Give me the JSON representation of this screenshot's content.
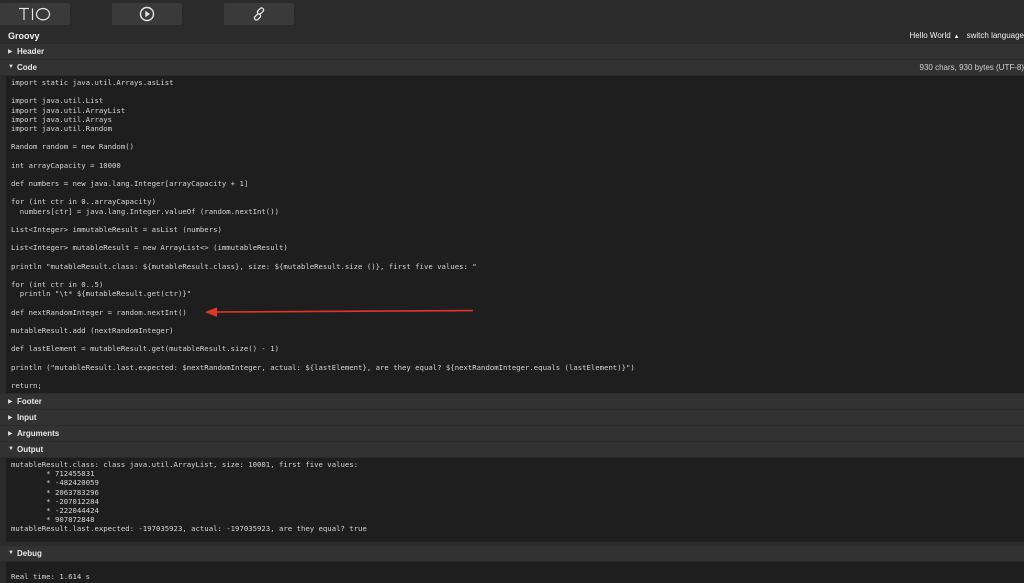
{
  "toolbar": {
    "logo": "TIO",
    "run_icon": "play-icon",
    "link_icon": "link-icon"
  },
  "language": {
    "name": "Groovy",
    "hello_world": "Hello World",
    "hello_world_icon": "triangle-up-icon",
    "switch_language": "switch language"
  },
  "sections": {
    "header": "Header",
    "code": "Code",
    "code_info": "930 chars, 930 bytes (UTF-8)",
    "footer": "Footer",
    "input": "Input",
    "arguments": "Arguments",
    "output": "Output",
    "debug": "Debug"
  },
  "code_lines": [
    "import static java.util.Arrays.asList",
    "",
    "import java.util.List",
    "import java.util.ArrayList",
    "import java.util.Arrays",
    "import java.util.Random",
    "",
    "Random random = new Random()",
    "",
    "int arrayCapacity = 10000",
    "",
    "def numbers = new java.lang.Integer[arrayCapacity + 1]",
    "",
    "for (int ctr in 0..arrayCapacity)",
    "  numbers[ctr] = java.lang.Integer.valueOf (random.nextInt())",
    "",
    "List<Integer> immutableResult = asList (numbers)",
    "",
    "List<Integer> mutableResult = new ArrayList<> (immutableResult)",
    "",
    "println \"mutableResult.class: ${mutableResult.class}, size: ${mutableResult.size ()}, first five values: \"",
    "",
    "for (int ctr in 0..5)",
    "  println \"\\t* ${mutableResult.get(ctr)}\"",
    "",
    "def nextRandomInteger = random.nextInt()",
    "",
    "mutableResult.add (nextRandomInteger)",
    "",
    "def lastElement = mutableResult.get(mutableResult.size() - 1)",
    "",
    "println (\"mutableResult.last.expected: $nextRandomInteger, actual: ${lastElement}, are they equal? ${nextRandomInteger.equals (lastElement)}\")",
    "",
    "return;"
  ],
  "output_lines": [
    "mutableResult.class: class java.util.ArrayList, size: 10001, first five values: ",
    "\t* 712455831",
    "\t* -482420059",
    "\t* 2063783296",
    "\t* -207012284",
    "\t* -222044424",
    "\t* 907872848",
    "mutableResult.last.expected: -197035923, actual: -197035923, are they equal? true"
  ],
  "debug_lines": [
    "Real time: 1.614 s"
  ],
  "annotation_color": "#e0352b"
}
